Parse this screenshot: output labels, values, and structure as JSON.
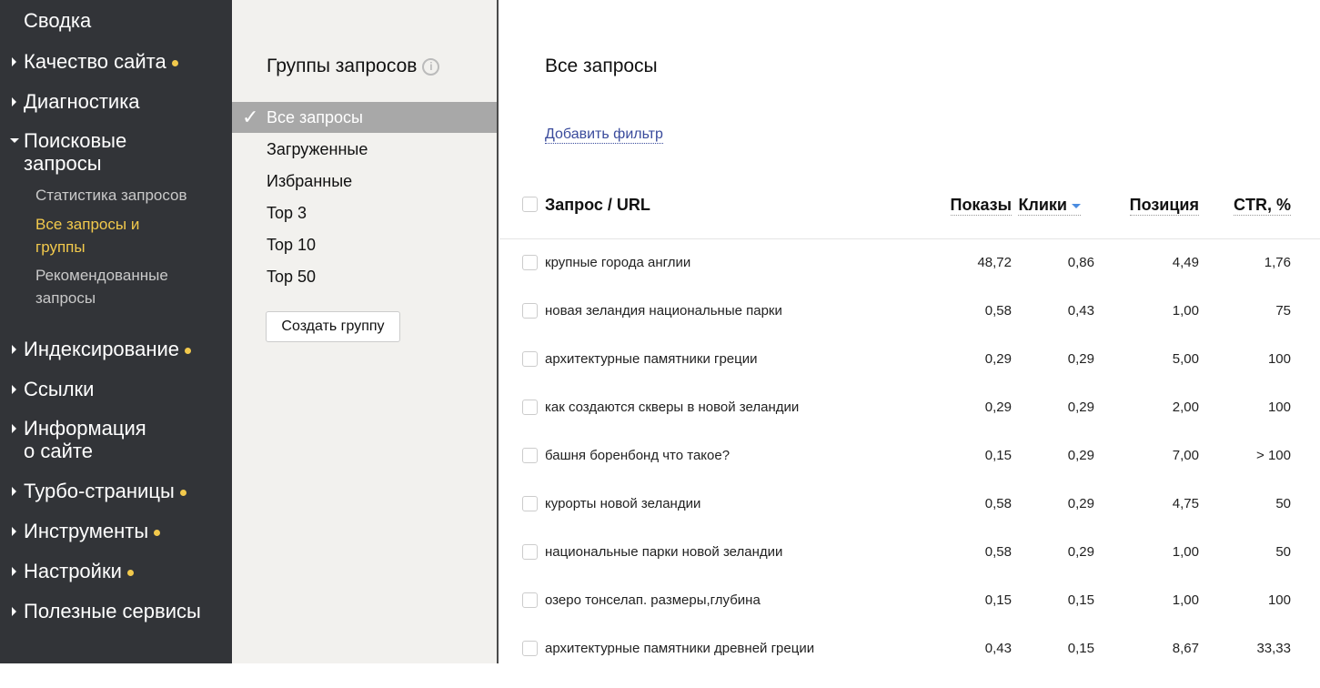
{
  "sidebar": {
    "items": [
      {
        "label": "Сводка"
      },
      {
        "label": "Качество сайта",
        "dot": true
      },
      {
        "label": "Диагностика"
      },
      {
        "label": "Поисковые запросы",
        "expanded": true
      },
      {
        "label": "Индексирование",
        "dot": true
      },
      {
        "label": "Ссылки"
      },
      {
        "label": "Информация о сайте"
      },
      {
        "label": "Турбо-страницы",
        "dot": true
      },
      {
        "label": "Инструменты",
        "dot": true
      },
      {
        "label": "Настройки",
        "dot": true
      },
      {
        "label": "Полезные сервисы"
      }
    ],
    "subitems": [
      {
        "label": "Статистика запросов"
      },
      {
        "label": "Все запросы и группы",
        "active": true
      },
      {
        "label": "Рекомендованные запросы"
      }
    ],
    "accent_color": "#f2c94c"
  },
  "groups": {
    "title": "Группы запросов",
    "info_icon": "i",
    "items": [
      "Все запросы",
      "Загруженные",
      "Избранные",
      "Top 3",
      "Top 10",
      "Top 50"
    ],
    "selected": "Все запросы",
    "check": "✓",
    "create_label": "Создать группу"
  },
  "main": {
    "title": "Все запросы",
    "add_filter": "Добавить фильтр",
    "columns": [
      "Запрос / URL",
      "Показы",
      "Клики",
      "Позиция",
      "CTR, %"
    ],
    "sorted_column": "Клики",
    "rows": [
      [
        "крупные города англии",
        "48,72",
        "0,86",
        "4,49",
        "1,76"
      ],
      [
        "новая зеландия национальные парки",
        "0,58",
        "0,43",
        "1,00",
        "75"
      ],
      [
        "архитектурные памятники греции",
        "0,29",
        "0,29",
        "5,00",
        "100"
      ],
      [
        "как создаются скверы в новой зеландии",
        "0,29",
        "0,29",
        "2,00",
        "100"
      ],
      [
        "башня боренбонд что такое?",
        "0,15",
        "0,29",
        "7,00",
        "> 100"
      ],
      [
        "курорты новой зеландии",
        "0,58",
        "0,29",
        "4,75",
        "50"
      ],
      [
        "национальные парки новой зеландии",
        "0,58",
        "0,29",
        "1,00",
        "50"
      ],
      [
        "озеро тонселап. размеры,глубина",
        "0,15",
        "0,15",
        "1,00",
        "100"
      ],
      [
        "архитектурные памятники древней греции",
        "0,43",
        "0,15",
        "8,67",
        "33,33"
      ]
    ]
  }
}
